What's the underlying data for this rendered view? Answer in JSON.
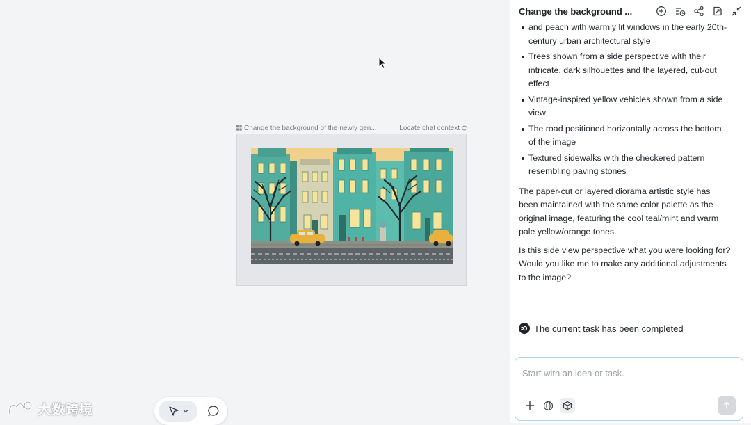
{
  "canvas": {
    "frame_title": "Change the background of the newly gen...",
    "locate_label": "Locate chat context",
    "image_alt": "Paper-cut diorama street of teal townhouses with trees and yellow cars"
  },
  "toolbar": {
    "select_tool": "pointer-tool",
    "comment_tool": "comment-tool"
  },
  "watermark": {
    "text": "大数跨境"
  },
  "panel": {
    "title": "Change the background ...",
    "header_icons": [
      "new-chat-icon",
      "history-icon",
      "share-icon",
      "export-icon",
      "collapse-icon"
    ],
    "partial_bullet": "and peach with warmly lit windows in the early 20th-century urban architectural style",
    "bullets": [
      "Trees shown from a side perspective with their intricate, dark silhouettes and the layered, cut-out effect",
      "Vintage-inspired yellow vehicles shown from a side view",
      "The road positioned horizontally across the bottom of the image",
      "Textured sidewalks with the checkered pattern resembling paving stones"
    ],
    "paragraph1": "The paper-cut or layered diorama artistic style has been maintained with the same color palette as the original image, featuring the cool teal/mint and warm pale yellow/orange tones.",
    "paragraph2": "Is this side view perspective what you were looking for? Would you like me to make any additional adjustments to the image?",
    "status": "The current task has been completed",
    "composer": {
      "placeholder": "Start with an idea or task.",
      "value": ""
    }
  },
  "colors": {
    "accent_border": "#a9d3ef",
    "teal": "#4fb3a6",
    "warm_yellow": "#f3dc8c",
    "car_yellow": "#e9b03c"
  }
}
